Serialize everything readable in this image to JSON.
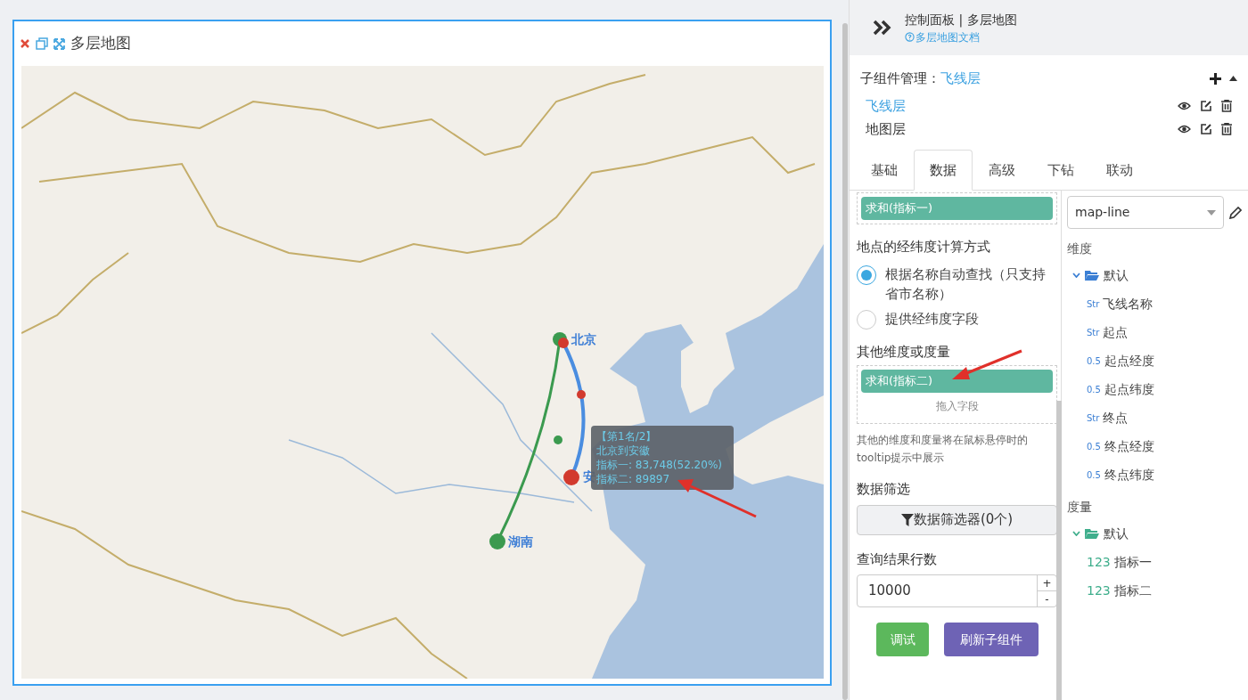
{
  "card": {
    "title": "多层地图",
    "map": {
      "labels": [
        {
          "text": "北京"
        },
        {
          "text": "湖南"
        },
        {
          "text": "安"
        }
      ],
      "tooltip": {
        "lines": [
          "【第1名/2】",
          "北京到安徽",
          "指标一: 83,748(52.20%)",
          "指标二: 89897"
        ]
      }
    }
  },
  "panel": {
    "title": "控制面板 | 多层地图",
    "doc_link": "多层地图文档",
    "sub_components": {
      "label": "子组件管理：",
      "current": "飞线层",
      "items": [
        {
          "name": "飞线层",
          "selected": true
        },
        {
          "name": "地图层",
          "selected": false
        }
      ]
    },
    "tabs": [
      {
        "label": "基础",
        "selected": false
      },
      {
        "label": "数据",
        "selected": true
      },
      {
        "label": "高级",
        "selected": false
      },
      {
        "label": "下钻",
        "selected": false
      },
      {
        "label": "联动",
        "selected": false
      }
    ],
    "data": {
      "top_chip": "求和(指标一)",
      "coord_title": "地点的经纬度计算方式",
      "coord_options": [
        {
          "label": "根据名称自动查找（只支持省市名称）",
          "selected": true
        },
        {
          "label": "提供经纬度字段",
          "selected": false
        }
      ],
      "other_title": "其他维度或度量",
      "other_chip": "求和(指标二)",
      "drop_hint": "拖入字段",
      "other_note": "其他的维度和度量将在鼠标悬停时的tooltip提示中展示",
      "filter_title": "数据筛选",
      "filter_button": "数据筛选器(0个)",
      "rows_title": "查询结果行数",
      "rows_value": "10000",
      "step_up": "+",
      "step_down": "-",
      "buttons": [
        {
          "label": "调试",
          "kind": "debug"
        },
        {
          "label": "刷新子组件",
          "kind": "refresh"
        }
      ]
    },
    "fields": {
      "dataset": "map-line",
      "groups": [
        {
          "title": "维度",
          "kind": "dimension",
          "folder": "默认",
          "expanded": true,
          "items": [
            {
              "type_label": "Str",
              "name": "飞线名称"
            },
            {
              "type_label": "Str",
              "name": "起点"
            },
            {
              "type_label": "0.5",
              "name": "起点经度"
            },
            {
              "type_label": "0.5",
              "name": "起点纬度"
            },
            {
              "type_label": "Str",
              "name": "终点"
            },
            {
              "type_label": "0.5",
              "name": "终点经度"
            },
            {
              "type_label": "0.5",
              "name": "终点纬度"
            }
          ]
        },
        {
          "title": "度量",
          "kind": "measure",
          "folder": "默认",
          "expanded": true,
          "items": [
            {
              "type_label": "123",
              "name": "指标一"
            },
            {
              "type_label": "123",
              "name": "指标二"
            }
          ]
        }
      ]
    }
  }
}
